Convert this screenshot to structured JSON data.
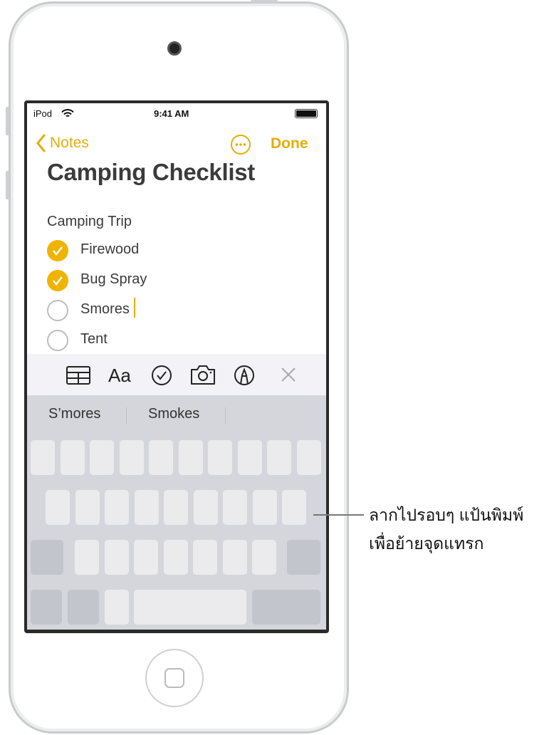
{
  "status_bar": {
    "carrier": "iPod",
    "time": "9:41 AM"
  },
  "nav": {
    "back_label": "Notes",
    "done_label": "Done",
    "more_icon": "ellipsis-circle-icon"
  },
  "note": {
    "title": "Camping Checklist",
    "heading": "Camping Trip",
    "items": [
      {
        "text": "Firewood",
        "checked": true
      },
      {
        "text": "Bug Spray",
        "checked": true
      },
      {
        "text": "Smores",
        "checked": false
      },
      {
        "text": "Tent",
        "checked": false
      }
    ]
  },
  "toolbar": {
    "icons": [
      "table-icon",
      "text-format-icon",
      "checklist-icon",
      "camera-icon",
      "markup-icon",
      "close-icon"
    ],
    "format_label": "Aa"
  },
  "suggestions": [
    "S’mores",
    "Smokes"
  ],
  "callout": {
    "line1": "ลากไปรอบๆ แป้นพิมพ์",
    "line2": "เพื่อย้ายจุดแทรก"
  },
  "colors": {
    "accent": "#e6ad0a",
    "check": "#f0b400",
    "keyboard": "#d5d6db"
  }
}
